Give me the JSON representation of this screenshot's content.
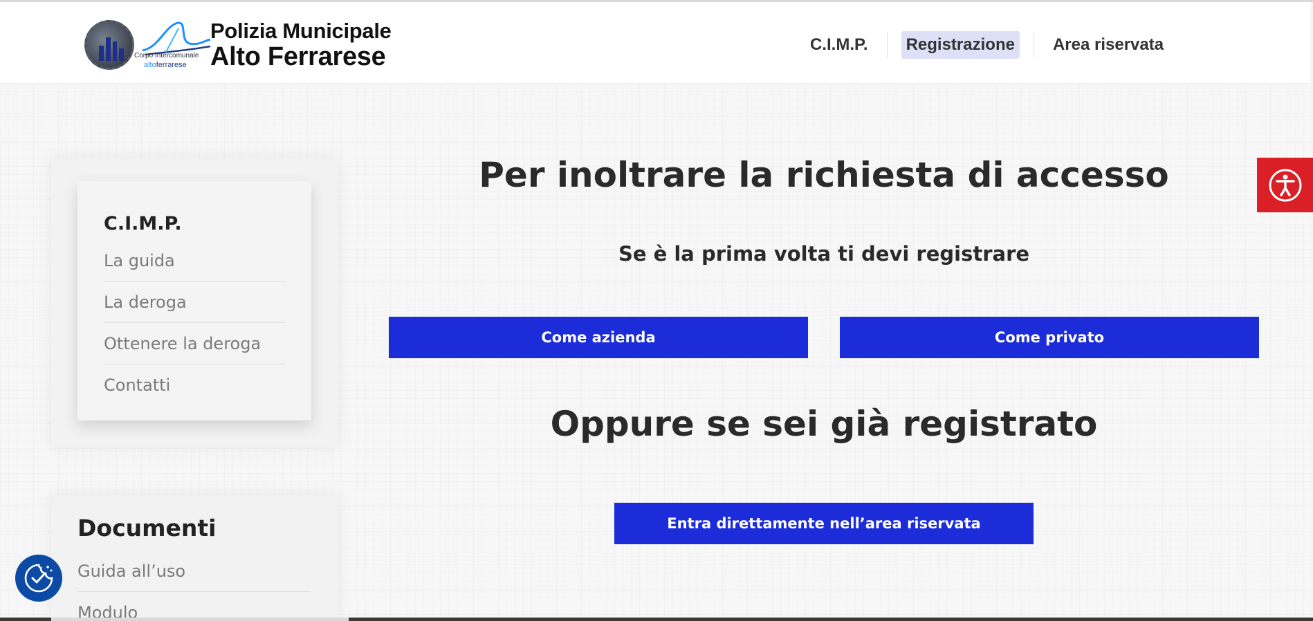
{
  "header": {
    "logo": {
      "line1": "Polizia Municipale",
      "line2": "Alto Ferrarese",
      "corpo": "Corpo Intercomunale",
      "alto": "alto",
      "ferrarese": "ferrarese"
    },
    "nav": [
      {
        "label": "C.I.M.P.",
        "active": false
      },
      {
        "label": "Registrazione",
        "active": true
      },
      {
        "label": "Area riservata",
        "active": false
      }
    ]
  },
  "sidebar": {
    "title": "C.I.M.P.",
    "items": [
      "La guida",
      "La deroga",
      "Ottenere la deroga",
      "Contatti"
    ]
  },
  "documents": {
    "title": "Documenti",
    "items": [
      "Guida all’uso",
      "Modulo"
    ]
  },
  "main": {
    "title": "Per inoltrare la richiesta di accesso",
    "subtitle": "Se è la prima volta ti devi registrare",
    "btn_azienda": "Come azienda",
    "btn_privato": "Come privato",
    "second_title": "Oppure se sei già registrato",
    "btn_area": "Entra direttamente nell’area riservata"
  },
  "widgets": {
    "accessibility_icon": "accessibility-icon",
    "cookie_icon": "cookie-consent-icon"
  },
  "colors": {
    "primary_button": "#1c2cd9",
    "nav_active_bg": "#dde0f7",
    "accessibility_bg": "#da1f26",
    "cookie_bg": "#0d4aa6"
  }
}
